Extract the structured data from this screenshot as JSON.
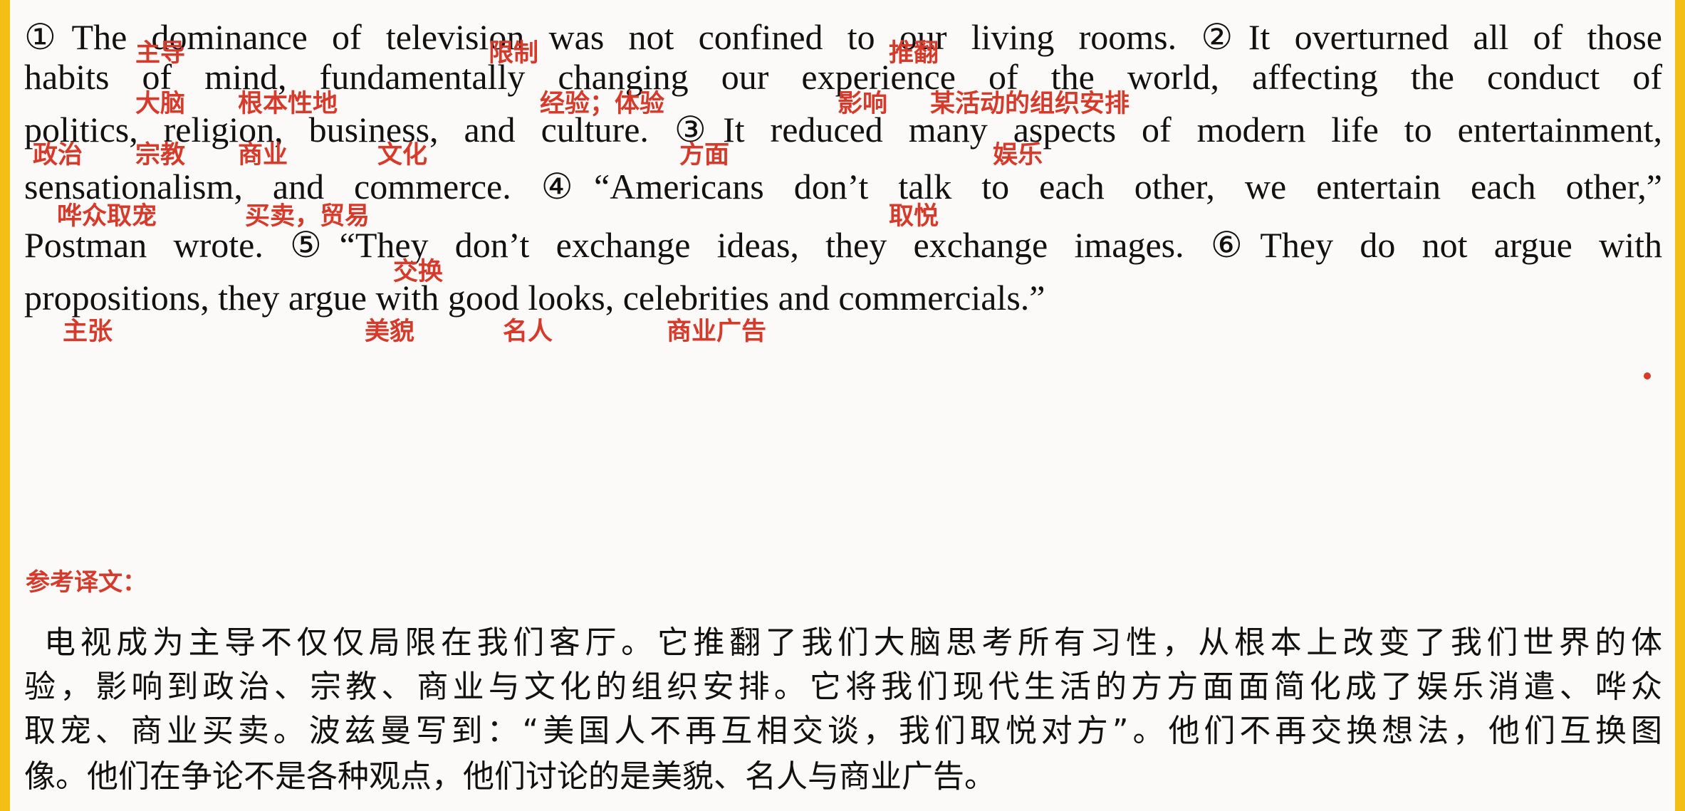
{
  "english_lines": [
    "①The dominance of television was not confined to our living rooms. ②It overturned all of those",
    "habits of mind, fundamentally changing our experience of the world, affecting the conduct of",
    "politics, religion, business, and culture. ③It reduced many aspects of modern life to entertainment,",
    "sensationalism, and commerce. ④“Americans don’t talk to each other, we entertain each other,”",
    "Postman wrote. ⑤“They don’t exchange ideas, they exchange images. ⑥They do not argue with",
    "propositions, they argue with good looks, celebrities and commercials.”"
  ],
  "annotations": {
    "row1": [
      "主导",
      "限制",
      "推翻"
    ],
    "row2": [
      "大脑",
      "根本性地",
      "经验；体验",
      "影响",
      "某活动的组织安排"
    ],
    "row3": [
      "政治",
      "宗教",
      "商业",
      "文化",
      "方面",
      "娱乐"
    ],
    "row4": [
      "哗众取宠",
      "买卖，贸易",
      "取悦"
    ],
    "row5": [
      "交换"
    ],
    "row6": [
      "主张",
      "美貌",
      "名人",
      "商业广告"
    ]
  },
  "reference_title": "参考译文：",
  "chinese_lines": [
    "电视成为主导不仅仅局限在我们客厅。它推翻了我们大脑思考所有习性，从根本上改变了我们世界的体",
    "验，影响到政治、宗教、商业与文化的组织安排。它将我们现代生活的方方面面简化成了娱乐消遣、哗众",
    "取宠、商业买卖。波兹曼写到：“美国人不再互相交谈，我们取悦对方”。他们不再交换想法，他们互换图",
    "像。他们在争论不是各种观点，他们讨论的是美貌、名人与商业广告。"
  ],
  "colors": {
    "frame": "#f6c21a",
    "annotation": "#d63a2b",
    "text": "#111111",
    "paper": "#fbfaf8"
  }
}
